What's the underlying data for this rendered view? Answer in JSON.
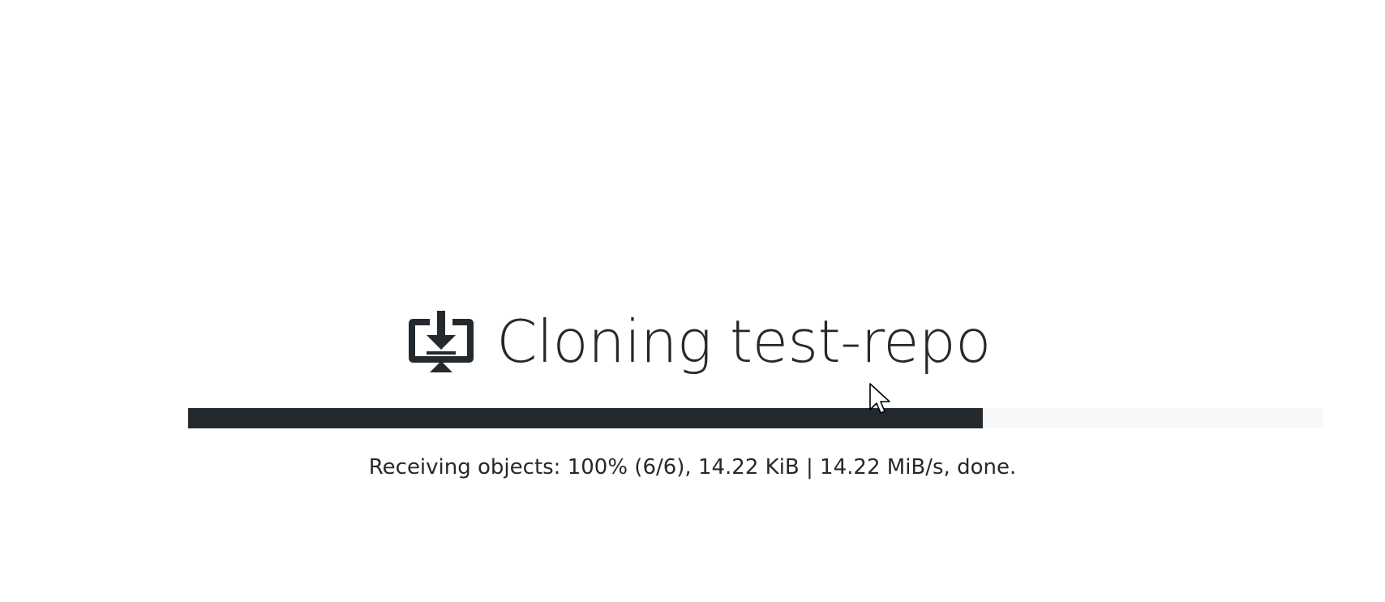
{
  "window": {
    "heading": {
      "icon": "desktop-download-icon",
      "title": "Cloning test-repo"
    },
    "progress": {
      "fraction": 0.7,
      "fill_color": "#24292e",
      "track_color": "#f6f8fa"
    },
    "status_text": "Receiving objects: 100% (6/6), 14.22 KiB | 14.22 MiB/s, done.",
    "pointer": "mouse-pointer-icon"
  }
}
